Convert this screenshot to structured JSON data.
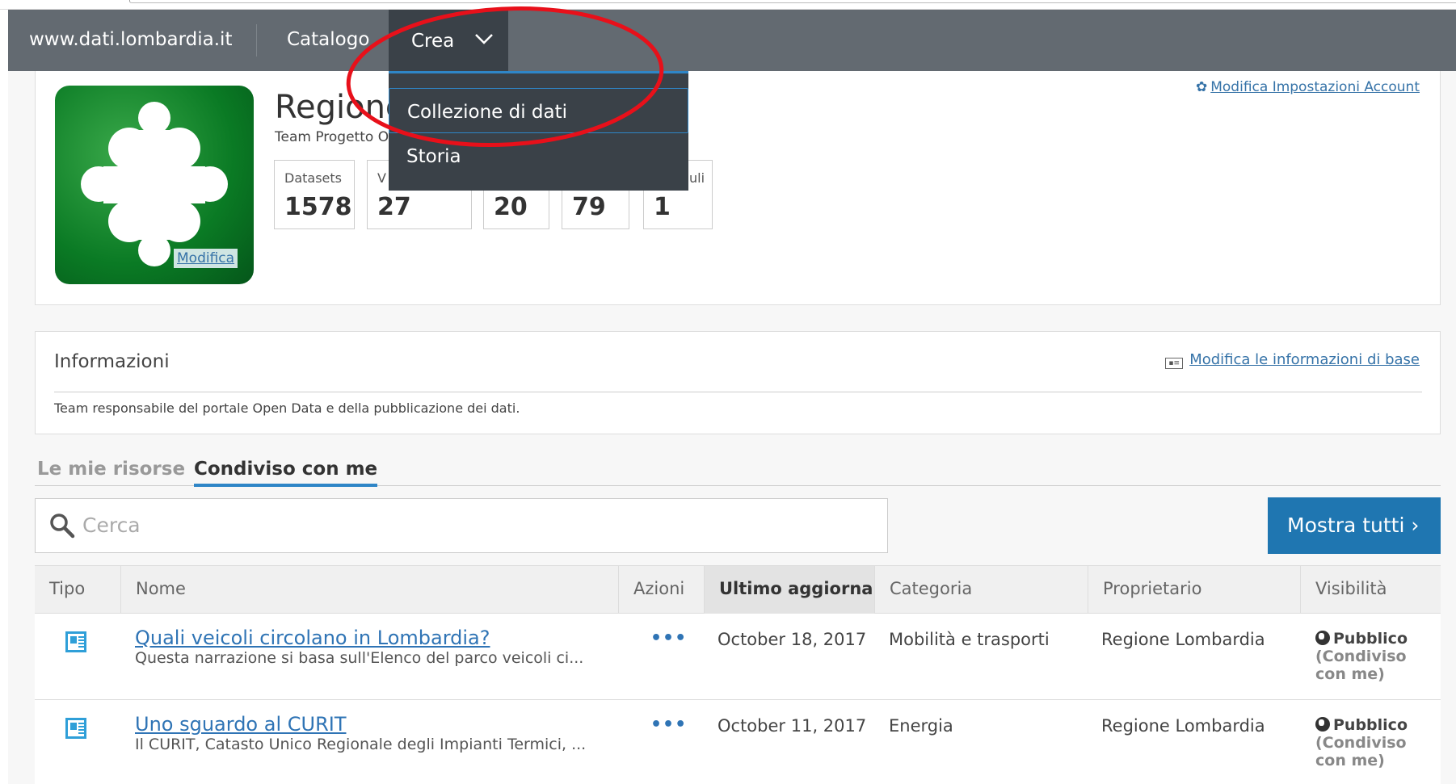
{
  "nav": {
    "site": "www.dati.lombardia.it",
    "catalogo": "Catalogo",
    "crea": "Crea",
    "dropdown": [
      "Collezione di dati",
      "Storia"
    ]
  },
  "profile": {
    "name": "Regione",
    "subtitle": "Team Progetto O",
    "edit_logo": "Modifica",
    "account_settings": "Modifica Impostazioni Account",
    "stats": [
      {
        "label": "Datasets",
        "value": "1578"
      },
      {
        "label": "V",
        "value": "27"
      },
      {
        "label": "",
        "value": "20"
      },
      {
        "label": "",
        "value": "79"
      },
      {
        "label": "uli",
        "value": "1"
      }
    ]
  },
  "info": {
    "title": "Informazioni",
    "edit_link": "Modifica le informazioni di base",
    "edit_icon": "id-card-icon",
    "description": "Team responsabile del portale Open Data e della pubblicazione dei dati."
  },
  "tabs": [
    "Le mie risorse",
    "Condiviso con me"
  ],
  "search": {
    "placeholder": "Cerca",
    "show_all": "Mostra tutti"
  },
  "table": {
    "headers": [
      "Tipo",
      "Nome",
      "Azioni",
      "Ultimo aggiornamento",
      "Categoria",
      "Proprietario",
      "Visibilità"
    ],
    "rows": [
      {
        "title": "Quali veicoli circolano in Lombardia?",
        "subtitle": "Questa narrazione si basa sull'Elenco del parco veicoli ci...",
        "actions": "•••",
        "updated": "October 18, 2017",
        "category": "Mobilità e trasporti",
        "owner": "Regione Lombardia",
        "visibility": "Pubblico",
        "shared": "(Condiviso con me)"
      },
      {
        "title": "Uno sguardo al CURIT",
        "subtitle": "Il CURIT, Catasto Unico Regionale degli Impianti Termici, ...",
        "actions": "•••",
        "updated": "October 11, 2017",
        "category": "Energia",
        "owner": "Regione Lombardia",
        "visibility": "Pubblico",
        "shared": "(Condiviso con me)"
      }
    ]
  },
  "colors": {
    "nav": "#636a71",
    "accent": "#1f76b1",
    "highlight": "#e8101a"
  }
}
